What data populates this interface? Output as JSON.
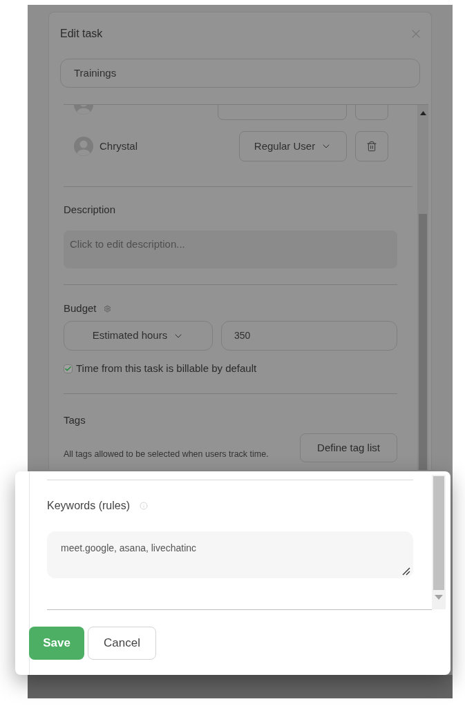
{
  "dialog": {
    "title": "Edit task",
    "task_name": "Trainings",
    "members": [
      {
        "kind": "cut_off"
      },
      {
        "kind": "full",
        "name": "Chrystal",
        "role": "Regular User"
      }
    ],
    "description": {
      "label": "Description",
      "placeholder": "Click to edit description..."
    },
    "budget": {
      "label": "Budget",
      "type": "Estimated hours",
      "value": "350",
      "billable": {
        "checked": true,
        "label": "Time from this task is billable by default"
      }
    },
    "tags": {
      "label": "Tags",
      "hint": "All tags allowed to be selected when users track time.",
      "button": "Define tag list"
    }
  },
  "keywords_panel": {
    "label": "Keywords (rules)",
    "value": "meet.google, asana, livechatinc",
    "buttons": [
      {
        "kind": "primary",
        "label": "Save"
      },
      {
        "kind": "secondary",
        "label": "Cancel"
      }
    ]
  }
}
